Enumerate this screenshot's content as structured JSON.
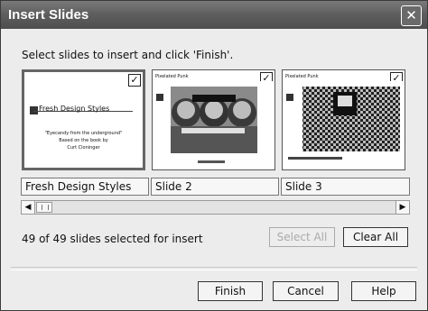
{
  "window": {
    "title": "Insert Slides"
  },
  "instruction": "Select slides to insert and click 'Finish'.",
  "slides": [
    {
      "label": "Fresh Design Styles",
      "preview_title": "Fresh Design Styles",
      "preview_subtitle": "\"Eyecandy from the underground\"",
      "preview_body_1": "Based on the book by",
      "preview_body_2": "Curt Cloninger"
    },
    {
      "label": "Slide 2",
      "preview_header": "Pixelated Punk"
    },
    {
      "label": "Slide 3",
      "preview_header": "Pixelated Punk"
    }
  ],
  "status": "49 of 49 slides selected for insert",
  "buttons": {
    "select_all": "Select All",
    "clear_all": "Clear All",
    "finish": "Finish",
    "cancel": "Cancel",
    "help": "Help"
  },
  "icons": {
    "close": "close-icon",
    "checkbox": "checkmark-icon",
    "scroll_left": "arrow-left-icon",
    "scroll_right": "arrow-right-icon",
    "grip": "scrollbar-grip-icon"
  }
}
